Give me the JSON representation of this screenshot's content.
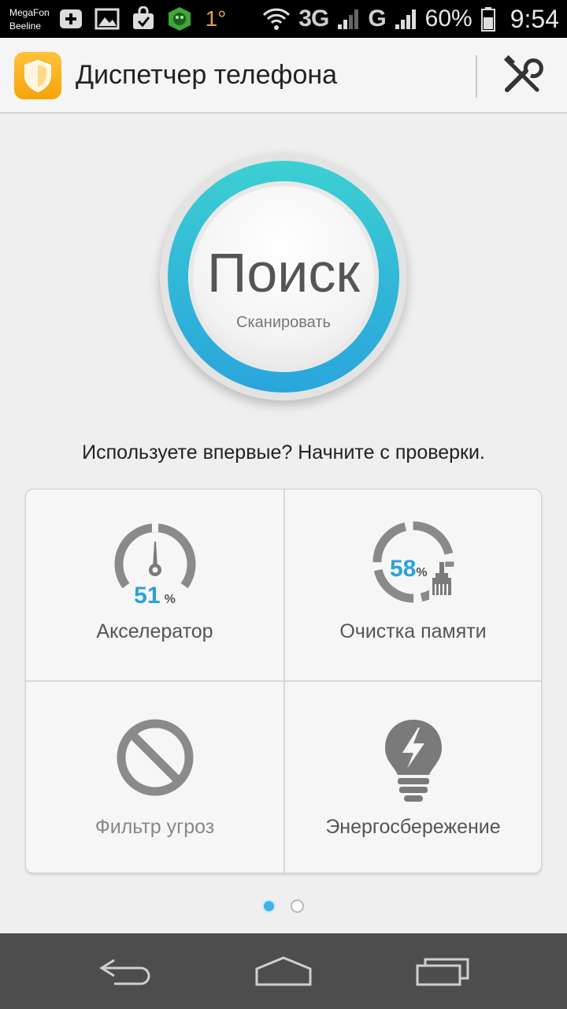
{
  "status_bar": {
    "carrier_1": "MegaFon",
    "carrier_2": "Beeline",
    "weather_temp": "1°",
    "network_1": "3G",
    "network_2": "G",
    "battery": "60%",
    "time": "9:54",
    "icons": [
      "add-icon",
      "image-icon",
      "shopping-bag-icon",
      "security-app-icon",
      "weather-icon",
      "wifi-icon",
      "signal-icon",
      "battery-icon"
    ]
  },
  "app_bar": {
    "title": "Диспетчер телефона",
    "icon": "shield-icon",
    "settings_icon": "tools-icon"
  },
  "scan": {
    "title": "Поиск",
    "subtitle": "Сканировать"
  },
  "hint": "Используете впервые? Начните с проверки.",
  "tiles": [
    {
      "label": "Акселератор",
      "value": "51",
      "unit": "%",
      "icon": "speedometer-icon",
      "level": 0.51
    },
    {
      "label": "Очистка памяти",
      "value": "58",
      "unit": "%",
      "icon": "broom-icon",
      "level": 0.58
    },
    {
      "label": "Фильтр угроз",
      "icon": "block-icon"
    },
    {
      "label": "Энергосбережение",
      "icon": "lightbulb-bolt-icon"
    }
  ],
  "pager": {
    "pages": 2,
    "current": 1
  },
  "nav": [
    "back-icon",
    "home-icon",
    "recents-icon"
  ],
  "colors": {
    "accent": "#29a3d8",
    "ring": "#31c0d6",
    "app_icon": "#f5a40a"
  }
}
